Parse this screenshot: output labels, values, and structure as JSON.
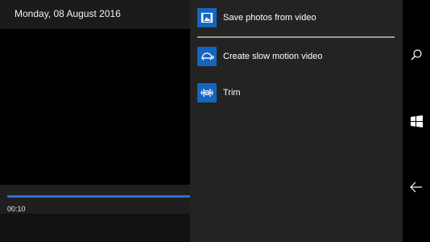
{
  "video": {
    "date": "Monday, 08 August 2016",
    "time": "00:10",
    "progress": 1.0
  },
  "menu": {
    "items": [
      {
        "label": "Save photos from video",
        "icon": "photo-film-icon"
      },
      {
        "label": "Create slow motion video",
        "icon": "turtle-icon"
      },
      {
        "label": "Trim",
        "icon": "trim-icon"
      }
    ]
  },
  "navbar": {
    "buttons": [
      "search-icon",
      "windows-icon",
      "back-arrow-icon"
    ]
  },
  "colors": {
    "accent": "#1565c0",
    "progress": "#2a6fd6",
    "panel": "#232323"
  }
}
